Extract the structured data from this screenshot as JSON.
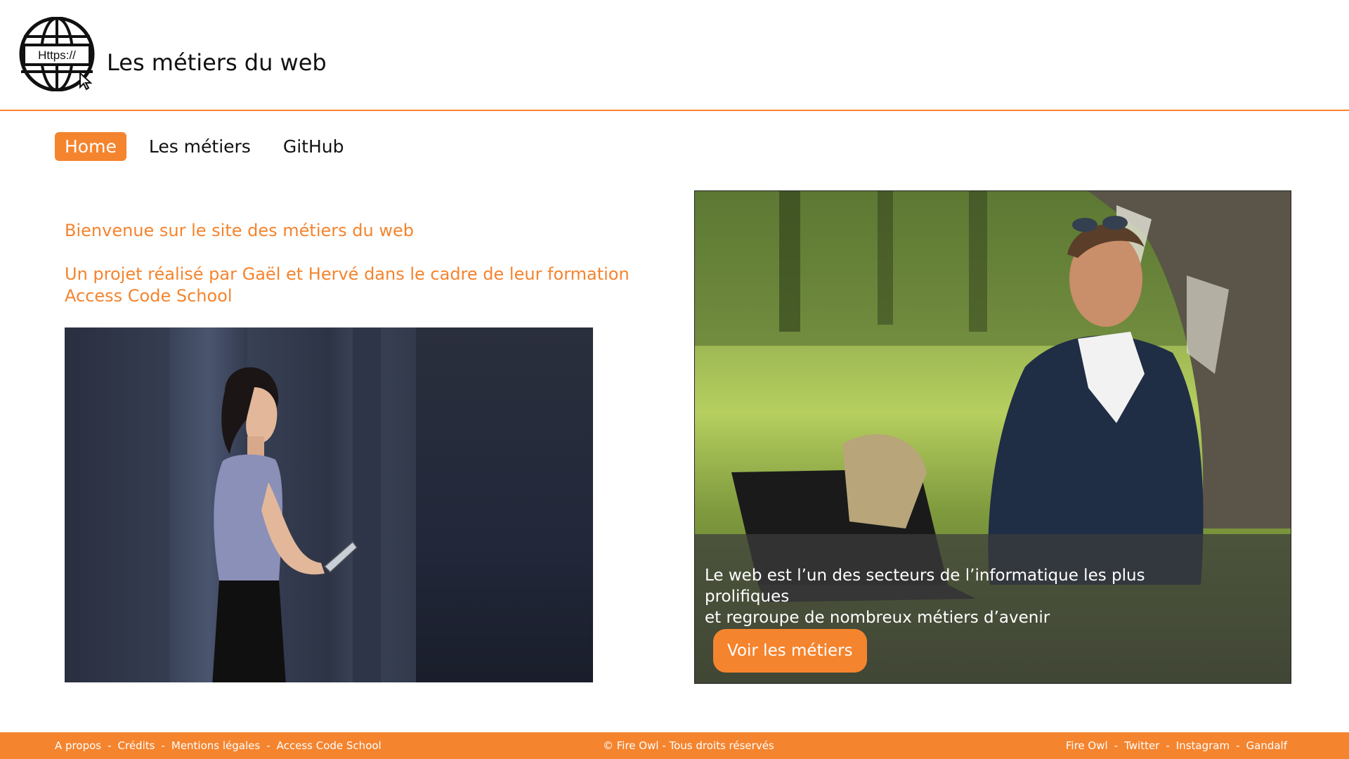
{
  "header": {
    "logo_text": "Https://",
    "title": "Les métiers du web"
  },
  "nav": {
    "items": [
      {
        "label": "Home",
        "active": true
      },
      {
        "label": "Les métiers",
        "active": false
      },
      {
        "label": "GitHub",
        "active": false
      }
    ]
  },
  "main": {
    "welcome": "Bienvenue sur le site des métiers du web",
    "project": "Un projet réalisé par Gaël et Hervé dans le cadre de leur formation Access Code School"
  },
  "hero": {
    "line1": "Le web est l’un des secteurs de l’informatique les plus prolifiques",
    "line2": "et regroupe de nombreux métiers d’avenir",
    "button": "Voir les métiers"
  },
  "footer": {
    "left_links": [
      "A propos",
      "Crédits",
      "Mentions légales",
      "Access Code School"
    ],
    "separator": "-",
    "copyright": "© Fire Owl - Tous droits réservés",
    "right_links": [
      "Fire Owl",
      "Twitter",
      "Instagram",
      "Gandalf"
    ]
  },
  "colors": {
    "accent": "#f5842e",
    "text": "#111111",
    "overlay": "rgba(60,60,60,0.72)"
  }
}
